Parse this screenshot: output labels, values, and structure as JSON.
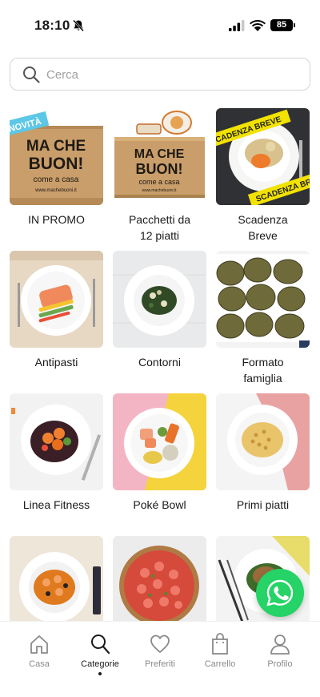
{
  "status_bar": {
    "time": "18:10",
    "battery": "85",
    "icons": [
      "bell-slash-icon",
      "signal-icon",
      "wifi-icon",
      "battery-icon"
    ]
  },
  "search": {
    "placeholder": "Cerca",
    "value": ""
  },
  "categories": [
    {
      "label": "IN PROMO",
      "image": "box-badge-novita",
      "badge": "NOVITÀ",
      "box_text": [
        "MA CHE",
        "BUON!",
        "come a casa"
      ],
      "box_url": "www.machebuoni.it"
    },
    {
      "label": "Pacchetti da\n12 piatti",
      "image": "box-with-dishes",
      "box_text": [
        "MA CHE",
        "BUON!",
        "come a casa"
      ],
      "box_url": "www.machebuoni.it"
    },
    {
      "label": "Scadenza\nBreve",
      "image": "dish-with-expiry-tape",
      "tape_text": [
        "SCADENZA BREVE",
        "SCADENZA BREVE"
      ]
    },
    {
      "label": "Antipasti",
      "image": "salmon-dish"
    },
    {
      "label": "Contorni",
      "image": "greens-dish"
    },
    {
      "label": "Formato\nfamiglia",
      "image": "grilled-eggplant-tray"
    },
    {
      "label": "Linea Fitness",
      "image": "fitness-dish"
    },
    {
      "label": "Poké Bowl",
      "image": "poke-bowl"
    },
    {
      "label": "Primi piatti",
      "image": "pasta-dish"
    },
    {
      "label": "",
      "image": "shrimp-soup"
    },
    {
      "label": "",
      "image": "pizza-tomatoes"
    },
    {
      "label": "",
      "image": "burger-salad"
    }
  ],
  "bottom_nav": [
    {
      "label": "Casa",
      "icon": "home-icon",
      "active": false
    },
    {
      "label": "Categorie",
      "icon": "search-icon",
      "active": true
    },
    {
      "label": "Preferiti",
      "icon": "heart-icon",
      "active": false
    },
    {
      "label": "Carrello",
      "icon": "bag-icon",
      "active": false
    },
    {
      "label": "Profilo",
      "icon": "user-icon",
      "active": false
    }
  ],
  "whatsapp": {
    "icon": "whatsapp-icon",
    "color": "#25d366"
  },
  "colors": {
    "accent": "#1a1a1a",
    "muted": "#8a8a8a",
    "box": "#c99e6a",
    "tape": "#f2e200"
  }
}
